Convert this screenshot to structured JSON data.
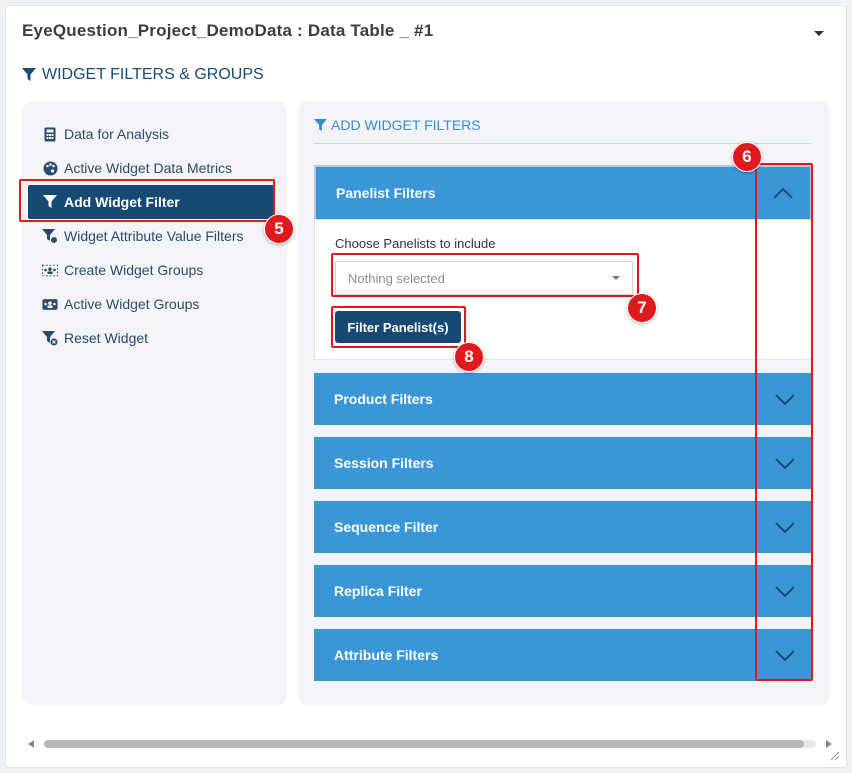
{
  "header": {
    "title": "EyeQuestion_Project_DemoData : Data Table _ #1",
    "section_title": "WIDGET FILTERS & GROUPS"
  },
  "sidebar": {
    "items": [
      {
        "label": "Data for Analysis",
        "icon": "calculator-icon",
        "active": false
      },
      {
        "label": "Active Widget Data Metrics",
        "icon": "palette-icon",
        "active": false
      },
      {
        "label": "Add Widget Filter",
        "icon": "filter-icon",
        "active": true
      },
      {
        "label": "Widget Attribute Value Filters",
        "icon": "filter-settings-icon",
        "active": false
      },
      {
        "label": "Create Widget Groups",
        "icon": "users-group-icon",
        "active": false
      },
      {
        "label": "Active Widget Groups",
        "icon": "users-rectangle-icon",
        "active": false
      },
      {
        "label": "Reset Widget",
        "icon": "filter-reset-icon",
        "active": false
      }
    ]
  },
  "main": {
    "title": "ADD WIDGET FILTERS",
    "panelist": {
      "header": "Panelist Filters",
      "choose_label": "Choose Panelists to include",
      "select_value": "Nothing selected",
      "button_label": "Filter Panelist(s)"
    },
    "accordions": [
      {
        "label": "Product Filters"
      },
      {
        "label": "Session Filters"
      },
      {
        "label": "Sequence Filter"
      },
      {
        "label": "Replica Filter"
      },
      {
        "label": "Attribute Filters"
      }
    ]
  },
  "annotations": {
    "badge5": "5",
    "badge6": "6",
    "badge7": "7",
    "badge8": "8"
  },
  "colors": {
    "accent_dark": "#164a75",
    "accordion_blue": "#3b96d8",
    "annotation_red": "#e0191e"
  }
}
